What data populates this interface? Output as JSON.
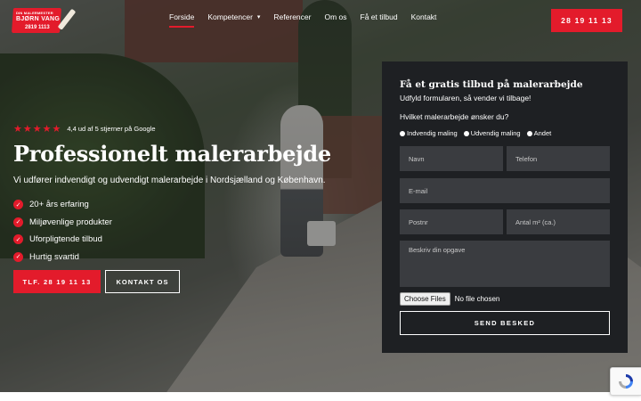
{
  "logo": {
    "line1": "DIN MALERMESTER",
    "line2": "BJØRN VANG",
    "line3": "2819 1113"
  },
  "nav": {
    "items": [
      {
        "label": "Forside",
        "active": true
      },
      {
        "label": "Kompetencer",
        "dropdown": true
      },
      {
        "label": "Referencer"
      },
      {
        "label": "Om os"
      },
      {
        "label": "Få et tilbud"
      },
      {
        "label": "Kontakt"
      }
    ],
    "phone_button": "28 19 11 13"
  },
  "hero": {
    "stars": "★★★★★",
    "rating_text": "4,4 ud af 5 stjerner på Google",
    "title": "Professionelt malerarbejde",
    "subtitle": "Vi udfører indvendigt og udvendigt malerarbejde i Nordsjælland og København.",
    "features": [
      "20+ års erfaring",
      "Miljøvenlige produkter",
      "Uforpligtende tilbud",
      "Hurtig svartid"
    ],
    "call_button": "TLF. 28 19 11 13",
    "contact_button": "KONTAKT OS"
  },
  "form": {
    "title": "Få et gratis tilbud på malerarbejde",
    "subtitle": "Udfyld formularen, så vender vi tilbage!",
    "question": "Hvilket malerarbejde ønsker du?",
    "options": [
      "Indvendig maling",
      "Udvendig maling",
      "Andet"
    ],
    "placeholders": {
      "name": "Navn",
      "phone": "Telefon",
      "email": "E-mail",
      "postal": "Postnr",
      "area": "Antal m² (ca.)",
      "description": "Beskriv din opgave"
    },
    "file_button": "Choose Files",
    "file_status": "No file chosen",
    "submit": "SEND BESKED"
  },
  "colors": {
    "accent": "#e31b2b",
    "panel": "#1e2023",
    "field": "#3a3c40"
  }
}
